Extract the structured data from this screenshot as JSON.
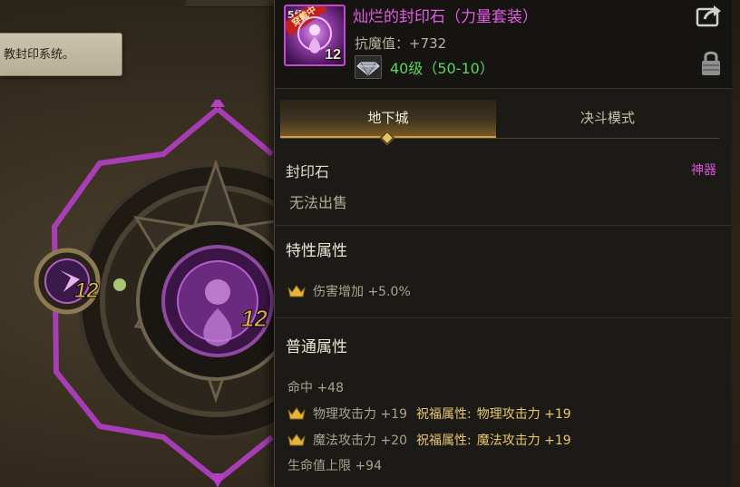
{
  "background": {
    "hint_text": "教封印系统。",
    "wheel_level_left": "12",
    "wheel_level_center": "12"
  },
  "item": {
    "name": "灿烂的封印石（力量套装）",
    "name_color": "#e55ce6",
    "icon_rank": "5级",
    "icon_badge": "穿戴中",
    "icon_level": "12",
    "anti_magic_label": "抗魔值：",
    "anti_magic_value": "+732",
    "level_text": "40级（50-10）",
    "level_color": "#58d65a"
  },
  "tabs": [
    {
      "label": "地下城",
      "active": true
    },
    {
      "label": "决斗模式",
      "active": false
    }
  ],
  "info": {
    "type_label": "封印石",
    "rarity": "神器",
    "rarity_color": "#d84fd8",
    "sell_text": "无法出售"
  },
  "special": {
    "title": "特性属性",
    "rows": [
      {
        "icon": "crown-icon",
        "text": "伤害增加 +5.0%"
      }
    ]
  },
  "common": {
    "title": "普通属性",
    "rows": [
      {
        "text": "命中 +48"
      },
      {
        "icon": "crown-icon",
        "text": "物理攻击力 +19",
        "bless_label": "祝福属性:",
        "bless_value": "物理攻击力 +19"
      },
      {
        "icon": "crown-icon",
        "text": "魔法攻击力 +20",
        "bless_label": "祝福属性:",
        "bless_value": "魔法攻击力 +19"
      },
      {
        "text": "生命值上限 +94"
      }
    ]
  },
  "icons": {
    "share": "share-icon",
    "lock": "lock-icon",
    "gem": "gem-icon"
  }
}
